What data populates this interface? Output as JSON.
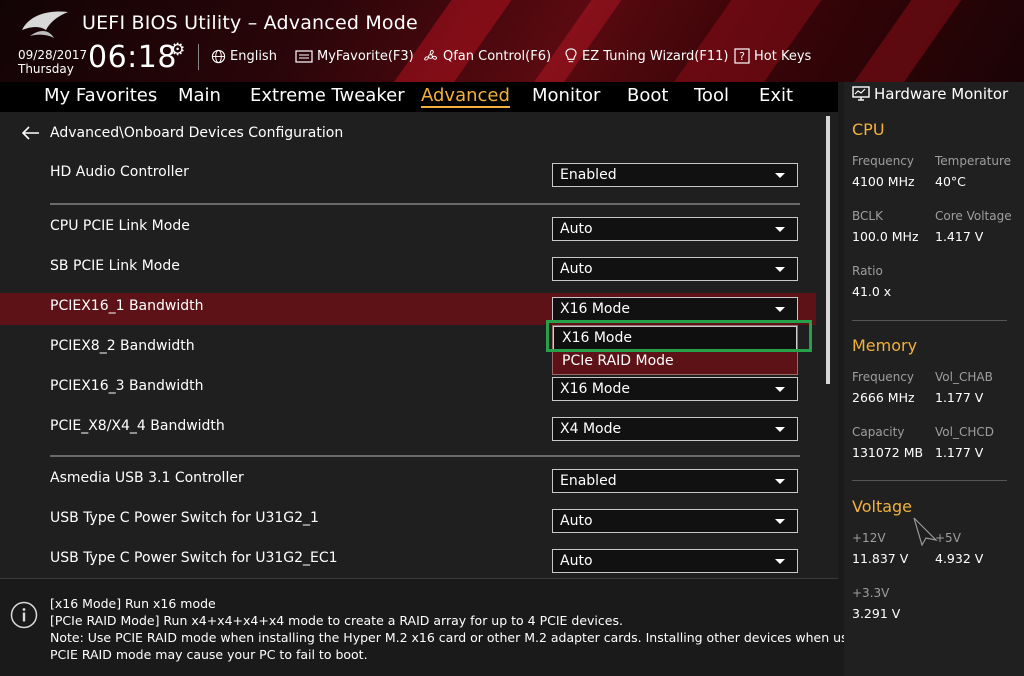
{
  "header": {
    "title": "UEFI BIOS Utility – Advanced Mode",
    "date": "09/28/2017",
    "day": "Thursday",
    "time": "06:18",
    "toolbar": {
      "language": "English",
      "myfavorite": "MyFavorite(F3)",
      "qfan": "Qfan Control(F6)",
      "ez_tuning": "EZ Tuning Wizard(F11)",
      "hotkeys": "Hot Keys"
    }
  },
  "menu": {
    "items": [
      "My Favorites",
      "Main",
      "Extreme Tweaker",
      "Advanced",
      "Monitor",
      "Boot",
      "Tool",
      "Exit"
    ],
    "active": "Advanced"
  },
  "main": {
    "breadcrumb": "Advanced\\Onboard Devices Configuration",
    "rows": [
      {
        "label": "HD Audio Controller",
        "value": "Enabled"
      },
      {
        "label": "CPU PCIE Link Mode",
        "value": "Auto"
      },
      {
        "label": "SB PCIE Link Mode",
        "value": "Auto"
      },
      {
        "label": "PCIEX16_1 Bandwidth",
        "value": "X16 Mode"
      },
      {
        "label": "PCIEX8_2 Bandwidth",
        "value": ""
      },
      {
        "label": "PCIEX16_3 Bandwidth",
        "value": "X16 Mode"
      },
      {
        "label": "PCIE_X8/X4_4 Bandwidth",
        "value": "X4 Mode"
      },
      {
        "label": "Asmedia USB 3.1 Controller",
        "value": "Enabled"
      },
      {
        "label": "USB Type C Power Switch for U31G2_1",
        "value": "Auto"
      },
      {
        "label": "USB Type C Power Switch for U31G2_EC1",
        "value": "Auto"
      }
    ],
    "dropdown": {
      "options": [
        "X16 Mode",
        "PCIe RAID Mode"
      ],
      "focused": "X16 Mode"
    }
  },
  "info": {
    "lines": [
      "[x16 Mode] Run x16 mode",
      "[PCIe RAID Mode] Run x4+x4+x4+x4 mode to create a RAID array for up to 4 PCIE devices.",
      "Note: Use PCIE RAID mode when installing the Hyper M.2 x16 card or other M.2 adapter cards. Installing other devices when using",
      "PCIE RAID mode may cause your PC to fail to boot."
    ]
  },
  "hardware_monitor": {
    "title": "Hardware Monitor",
    "cpu": {
      "heading": "CPU",
      "frequency_label": "Frequency",
      "frequency": "4100 MHz",
      "temperature_label": "Temperature",
      "temperature": "40°C",
      "bclk_label": "BCLK",
      "bclk": "100.0 MHz",
      "core_voltage_label": "Core Voltage",
      "core_voltage": "1.417 V",
      "ratio_label": "Ratio",
      "ratio": "41.0 x"
    },
    "memory": {
      "heading": "Memory",
      "frequency_label": "Frequency",
      "frequency": "2666 MHz",
      "vol_chab_label": "Vol_CHAB",
      "vol_chab": "1.177 V",
      "capacity_label": "Capacity",
      "capacity": "131072 MB",
      "vol_chcd_label": "Vol_CHCD",
      "vol_chcd": "1.177 V"
    },
    "voltage": {
      "heading": "Voltage",
      "v12_label": "+12V",
      "v12": "11.837 V",
      "v5_label": "+5V",
      "v5": "4.932 V",
      "v33_label": "+3.3V",
      "v33": "3.291 V"
    }
  },
  "colors": {
    "accent": "#f2b13c",
    "selected_row": "#5c1216",
    "focus_outline": "#27a04a",
    "header_red": "#5a0a10"
  }
}
